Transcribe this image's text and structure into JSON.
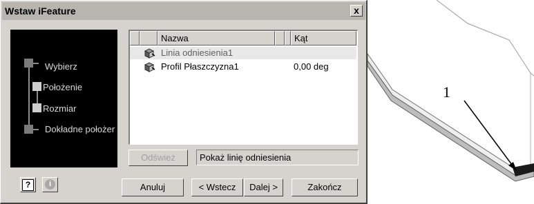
{
  "dialog": {
    "title": "Wstaw iFeature",
    "close_label": "x"
  },
  "wizard": {
    "steps": [
      {
        "label": "Wybierz",
        "state": "done"
      },
      {
        "label": "Położenie",
        "state": "active"
      },
      {
        "label": "Rozmiar",
        "state": "active"
      },
      {
        "label": "Dokładne położer",
        "state": "done"
      }
    ]
  },
  "list": {
    "columns": [
      "Nazwa",
      "Kąt"
    ],
    "rows": [
      {
        "name": "Linia odniesienia1",
        "angle": "",
        "selected": true
      },
      {
        "name": "Profil Płaszczyzna1",
        "angle": "0,00 deg",
        "selected": false
      }
    ]
  },
  "refresh_label": "Odśwież",
  "status_text": "Pokaż linię odniesienia",
  "buttons": {
    "cancel": "Anuluj",
    "back": "< Wstecz",
    "next": "Dalej >",
    "finish": "Zakończ"
  },
  "help_icons": {
    "help": "?",
    "info": "i"
  },
  "drawing": {
    "callout_label": "1"
  },
  "colors": {
    "dialog_bg": "#d6d3ce",
    "wizard_bg": "#000000",
    "step_done": "#7a7a7a",
    "step_active": "#cfcfcf"
  }
}
